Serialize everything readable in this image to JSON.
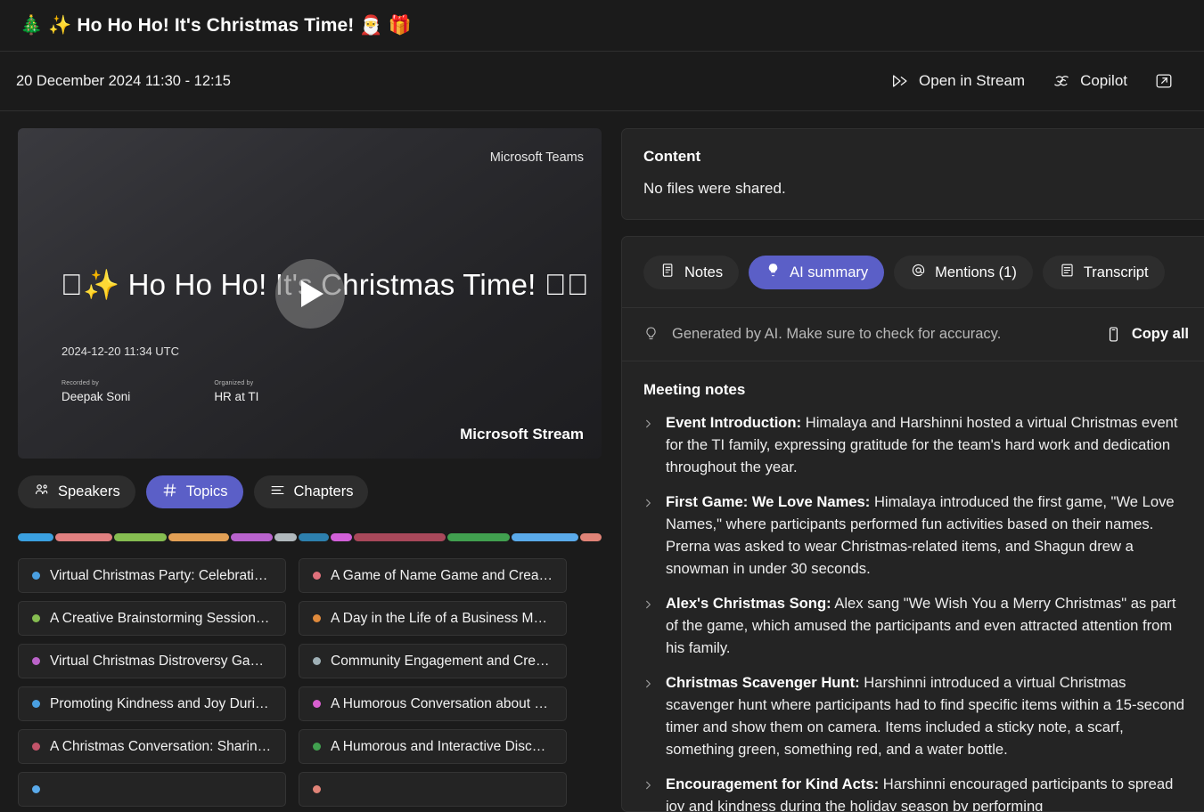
{
  "header": {
    "title": "🎄 ✨ Ho Ho Ho! It's Christmas Time! 🎅 🎁",
    "meeting_time": "20 December 2024 11:30 - 12:15",
    "actions": [
      {
        "label": "Open in Stream",
        "icon": "stream-play-icon"
      },
      {
        "label": "Copilot",
        "icon": "copilot-icon"
      },
      {
        "label": "",
        "icon": "open-external-icon"
      }
    ]
  },
  "video": {
    "brand_top": "Microsoft Teams",
    "brand_bottom": "Microsoft Stream",
    "title": "􀀀✨ Ho Ho Ho! It's Christmas Time! 􀀀􀀀",
    "date": "2024-12-20 11:34 UTC",
    "recorded_by_label": "Recorded by",
    "recorded_by": "Deepak  Soni",
    "organized_by_label": "Organized by",
    "organized_by": "HR at TI",
    "play_label": "Play"
  },
  "left_tabs": [
    {
      "label": "Speakers",
      "icon": "people-icon",
      "active": false
    },
    {
      "label": "Topics",
      "icon": "hash-icon",
      "active": true
    },
    {
      "label": "Chapters",
      "icon": "list-icon",
      "active": false
    }
  ],
  "timeline": [
    {
      "color": "#3aa0e0",
      "weight": 42
    },
    {
      "color": "#e08080",
      "weight": 68
    },
    {
      "color": "#86bd51",
      "weight": 62
    },
    {
      "color": "#e2a055",
      "weight": 72
    },
    {
      "color": "#b963cd",
      "weight": 50
    },
    {
      "color": "#b0b8bc",
      "weight": 26
    },
    {
      "color": "#2d80ae",
      "weight": 36
    },
    {
      "color": "#d160d8",
      "weight": 26
    },
    {
      "color": "#a8485a",
      "weight": 108
    },
    {
      "color": "#41a04f",
      "weight": 74
    },
    {
      "color": "#5aaaea",
      "weight": 80
    },
    {
      "color": "#e08377",
      "weight": 25
    }
  ],
  "topics": [
    {
      "label": "Virtual Christmas Party: Celebrating ...",
      "color": "#4a9fe0"
    },
    {
      "label": "A Game of Name Game and Creativity",
      "color": "#e0717c"
    },
    {
      "label": "A Creative Brainstorming Session: Fr...",
      "color": "#86bd51"
    },
    {
      "label": "A Day in the Life of a Business Meeti...",
      "color": "#e08a3c"
    },
    {
      "label": "Virtual Christmas Distroversy Game ...",
      "color": "#bb63c9"
    },
    {
      "label": "Community Engagement and Creati...",
      "color": "#9fb0b6"
    },
    {
      "label": "Promoting Kindness and Joy During...",
      "color": "#4a9fe0"
    },
    {
      "label": "A Humorous Conversation about Ch...",
      "color": "#d85fd0"
    },
    {
      "label": "A Christmas Conversation: Sharing C...",
      "color": "#c2546a"
    },
    {
      "label": "A Humorous and Interactive Discuss...",
      "color": "#41a04f"
    },
    {
      "label": "",
      "color": "#5aaaea"
    },
    {
      "label": "",
      "color": "#e08377"
    }
  ],
  "content": {
    "heading": "Content",
    "empty_text": "No files were shared."
  },
  "right_tabs": [
    {
      "label": "Notes",
      "icon": "notes-icon",
      "active": false
    },
    {
      "label": "AI summary",
      "icon": "lightbulb-icon",
      "active": true
    },
    {
      "label": "Mentions (1)",
      "icon": "at-icon",
      "active": false
    },
    {
      "label": "Transcript",
      "icon": "transcript-icon",
      "active": false
    }
  ],
  "ai_bar": {
    "disclaimer": "Generated by AI. Make sure to check for accuracy.",
    "copy_all_label": "Copy all",
    "icon": "lightbulb-icon",
    "copy_icon": "copy-icon"
  },
  "notes": {
    "title": "Meeting notes",
    "items": [
      {
        "heading": "Event Introduction:",
        "body": " Himalaya and Harshinni hosted a virtual Christmas event for the TI family, expressing gratitude for the team's hard work and dedication throughout the year."
      },
      {
        "heading": "First Game: We Love Names:",
        "body": " Himalaya introduced the first game, \"We Love Names,\" where participants performed fun activities based on their names. Prerna was asked to wear Christmas-related items, and Shagun drew a snowman in under 30 seconds."
      },
      {
        "heading": "Alex's Christmas Song:",
        "body": " Alex sang \"We Wish You a Merry Christmas\" as part of the game, which amused the participants and even attracted attention from his family."
      },
      {
        "heading": "Christmas Scavenger Hunt:",
        "body": " Harshinni introduced a virtual Christmas scavenger hunt where participants had to find specific items within a 15-second timer and show them on camera. Items included a sticky note, a scarf, something green, something red, and a water bottle."
      },
      {
        "heading": "Encouragement for Kind Acts:",
        "body": " Harshinni encouraged participants to spread joy and kindness during the holiday season by performing"
      }
    ]
  },
  "colors": {
    "accent": "#5b5fc7",
    "page_bg": "#1b1b1b",
    "card_bg": "#242424"
  }
}
